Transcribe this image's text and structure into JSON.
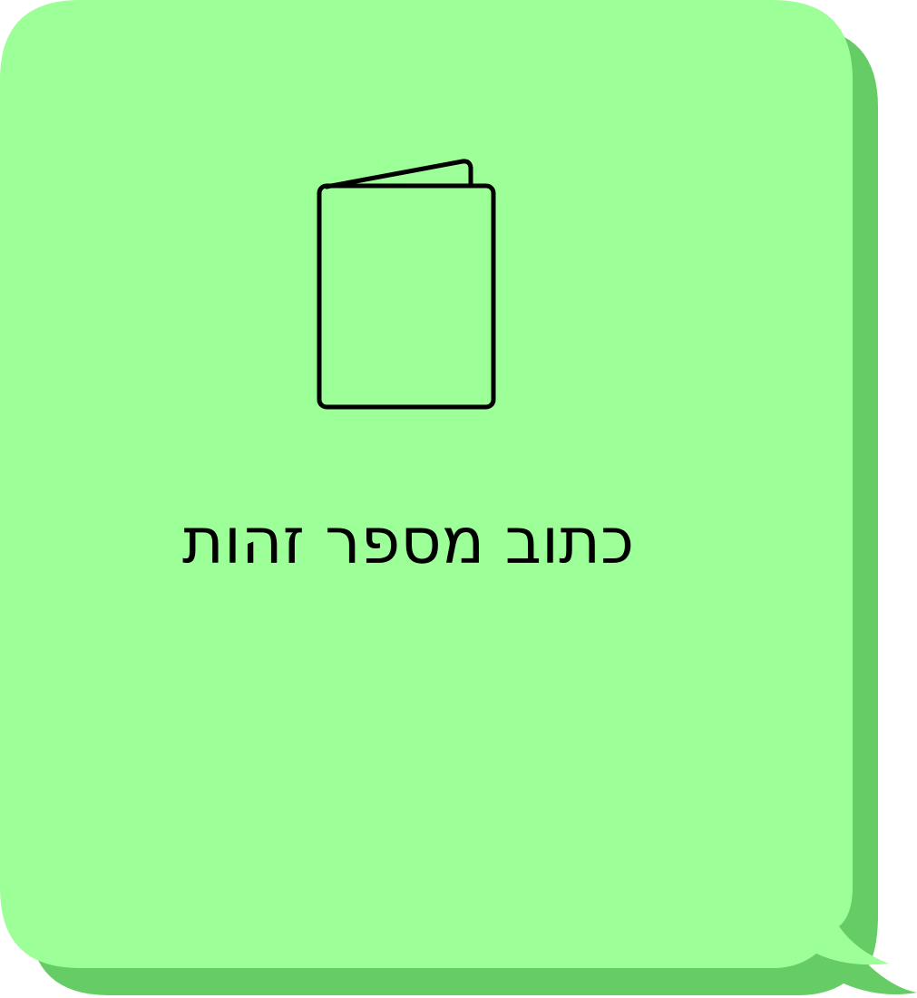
{
  "card": {
    "label": "כתוב מספר זהות",
    "icon": "id-card-icon",
    "fill_color": "#9dff98",
    "shadow_color": "#66cc66",
    "stroke_color": "#000000"
  }
}
